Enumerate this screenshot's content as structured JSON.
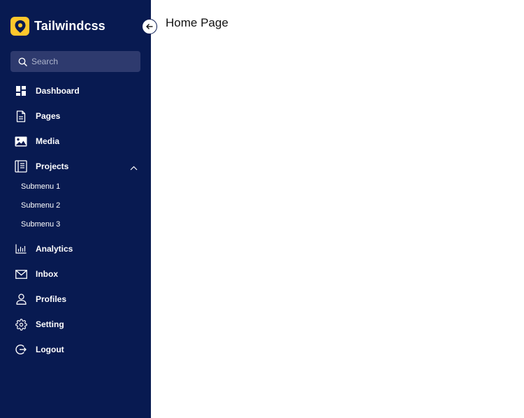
{
  "brand": {
    "name": "Tailwindcss",
    "logo_color": "#FFC72C"
  },
  "colors": {
    "sidebar_bg": "#081A51",
    "search_bg": "#2E3A6E"
  },
  "search": {
    "placeholder": "Search"
  },
  "menu": [
    {
      "label": "Dashboard",
      "icon": "dashboard-icon"
    },
    {
      "label": "Pages",
      "icon": "page-icon"
    },
    {
      "label": "Media",
      "icon": "image-icon"
    },
    {
      "label": "Projects",
      "icon": "projects-icon",
      "expanded": true,
      "submenu": [
        "Submenu 1",
        "Submenu 2",
        "Submenu 3"
      ]
    },
    {
      "label": "Analytics",
      "icon": "analytics-icon"
    },
    {
      "label": "Inbox",
      "icon": "mail-icon"
    },
    {
      "label": "Profiles",
      "icon": "user-icon"
    },
    {
      "label": "Setting",
      "icon": "gear-icon"
    },
    {
      "label": "Logout",
      "icon": "logout-icon"
    }
  ],
  "main": {
    "title": "Home Page"
  }
}
